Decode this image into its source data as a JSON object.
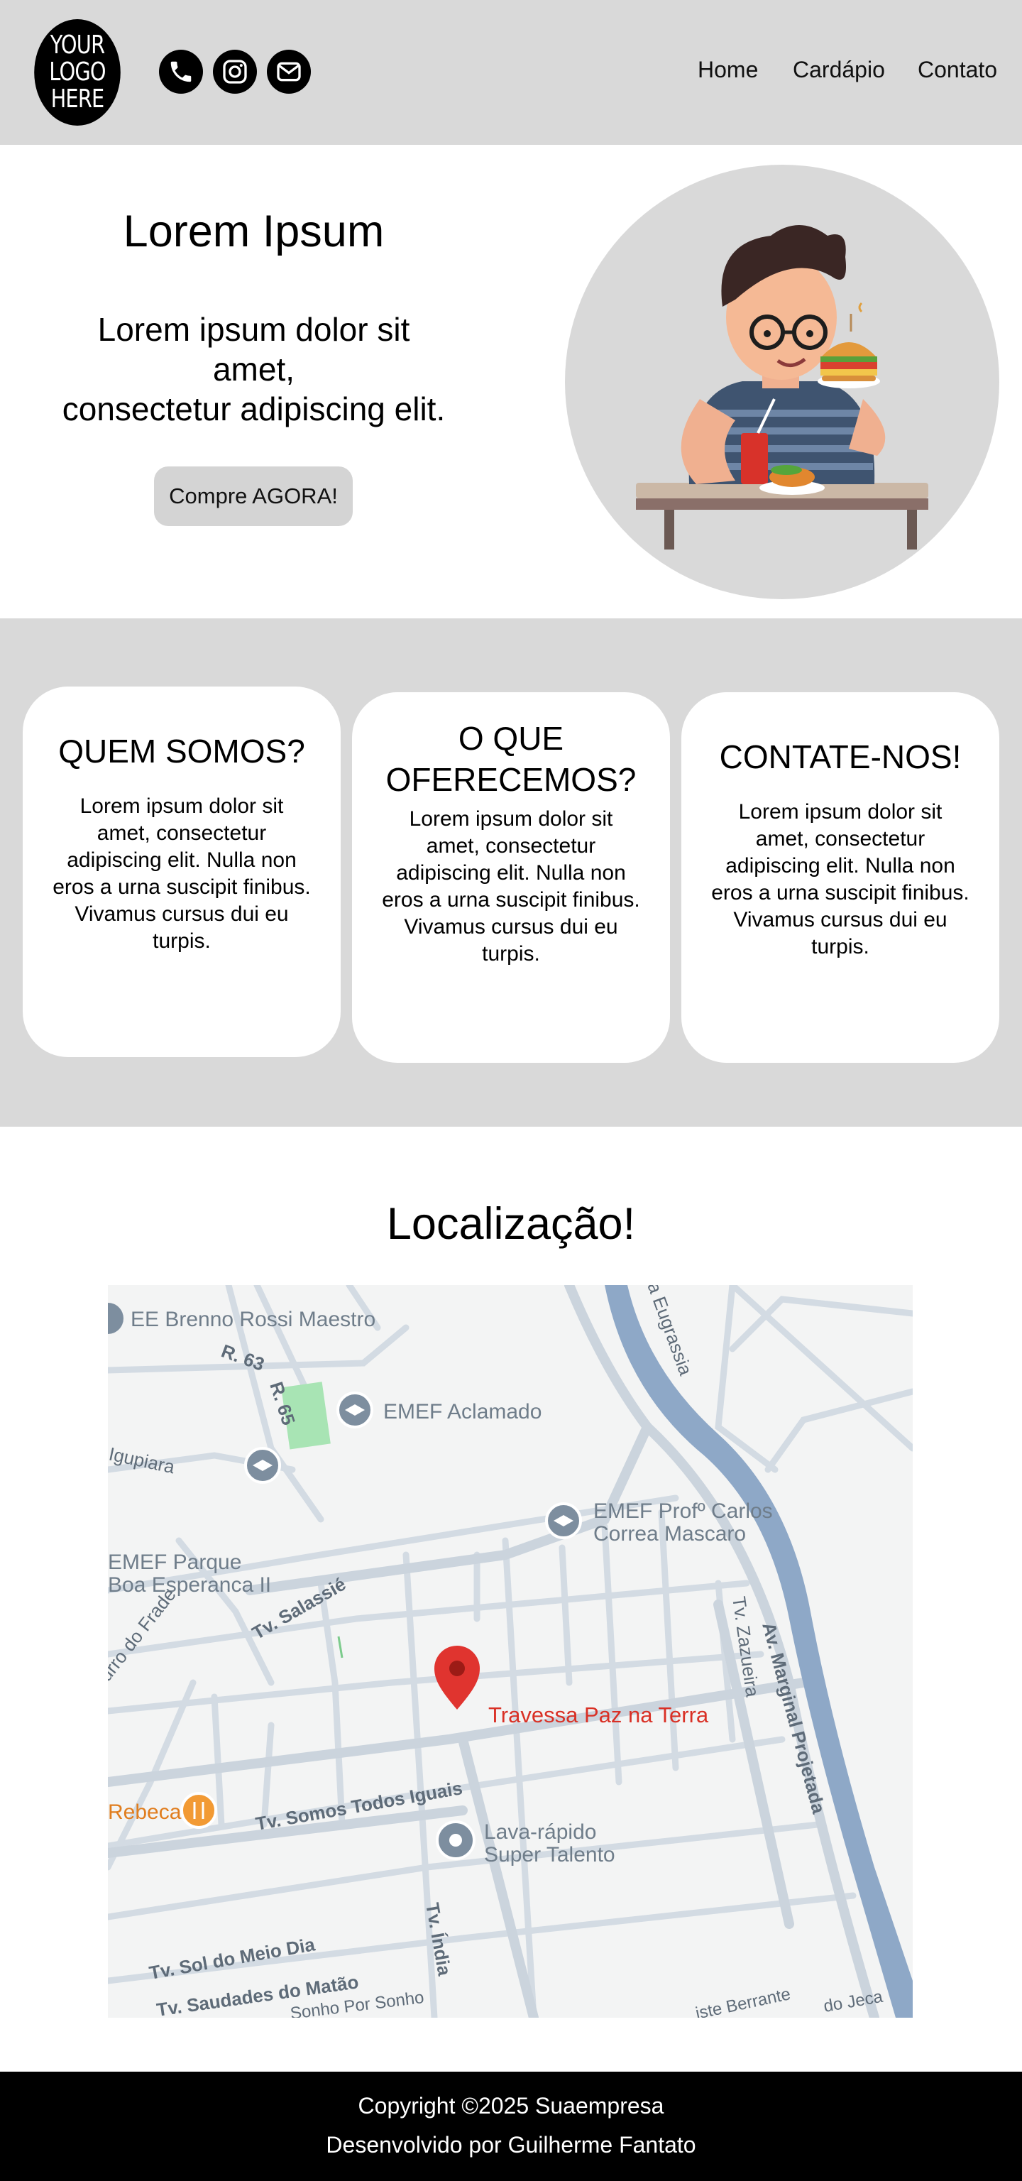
{
  "header": {
    "logo_lines": [
      "YOUR",
      "LOGO",
      "HERE"
    ],
    "social_icons": [
      "phone-icon",
      "instagram-icon",
      "mail-icon"
    ],
    "nav": [
      "Home",
      "Cardápio",
      "Contato"
    ]
  },
  "hero": {
    "title": "Lorem Ipsum",
    "subtitle_line1": "Lorem ipsum dolor sit amet,",
    "subtitle_line2": "consectetur adipiscing elit.",
    "cta_label": "Compre AGORA!",
    "illustration": "man-eating-burger-illustration"
  },
  "cards": [
    {
      "title": "QUEM SOMOS?",
      "text": "Lorem ipsum dolor sit amet, consectetur adipiscing elit. Nulla non eros a urna suscipit finibus. Vivamus cursus dui eu turpis."
    },
    {
      "title": "O QUE OFERECEMOS?",
      "text": "Lorem ipsum dolor sit amet, consectetur adipiscing elit. Nulla non eros a urna suscipit finibus. Vivamus cursus dui eu turpis."
    },
    {
      "title": "CONTATE-NOS!",
      "text": "Lorem ipsum dolor sit amet, consectetur adipiscing elit. Nulla non eros a urna suscipit finibus. Vivamus cursus dui eu turpis."
    }
  ],
  "location": {
    "title": "Localização!",
    "map": {
      "pin_label": "Travessa Paz na Terra",
      "places": [
        "EE Brenno Rossi Maestro",
        "EMEF Aclamado",
        "EMEF Profº Carlos",
        "Correa Mascaro",
        "EMEF Parque",
        "Boa Esperanca II",
        "Lava-rápido",
        "Super Talento",
        "Rebeca"
      ],
      "streets": [
        "R. 63",
        "R. 65",
        "Igupiara",
        "Tv. Salassié",
        "Tv. Zazueira",
        "Av. Marginal Projetada",
        "Tv. Somos Todos Iguais",
        "Tv. Índia",
        "Tv. Sol do Meio Dia",
        "Tv. Saudades do Matão",
        "Sonho Por Sonho",
        "a Eugrassia",
        "urro do Frade",
        "iste Berrante",
        "do Jeca"
      ]
    }
  },
  "footer": {
    "copyright": "Copyright ©2025 Suaempresa",
    "developer": "Desenvolvido por Guilherme Fantato"
  },
  "colors": {
    "band_gray": "#d9d9d9",
    "card_white": "#ffffff",
    "footer_black": "#000000",
    "map_river": "#8ea8c7",
    "map_pin": "#e0342f",
    "map_label_gray": "#6f7d8a"
  }
}
